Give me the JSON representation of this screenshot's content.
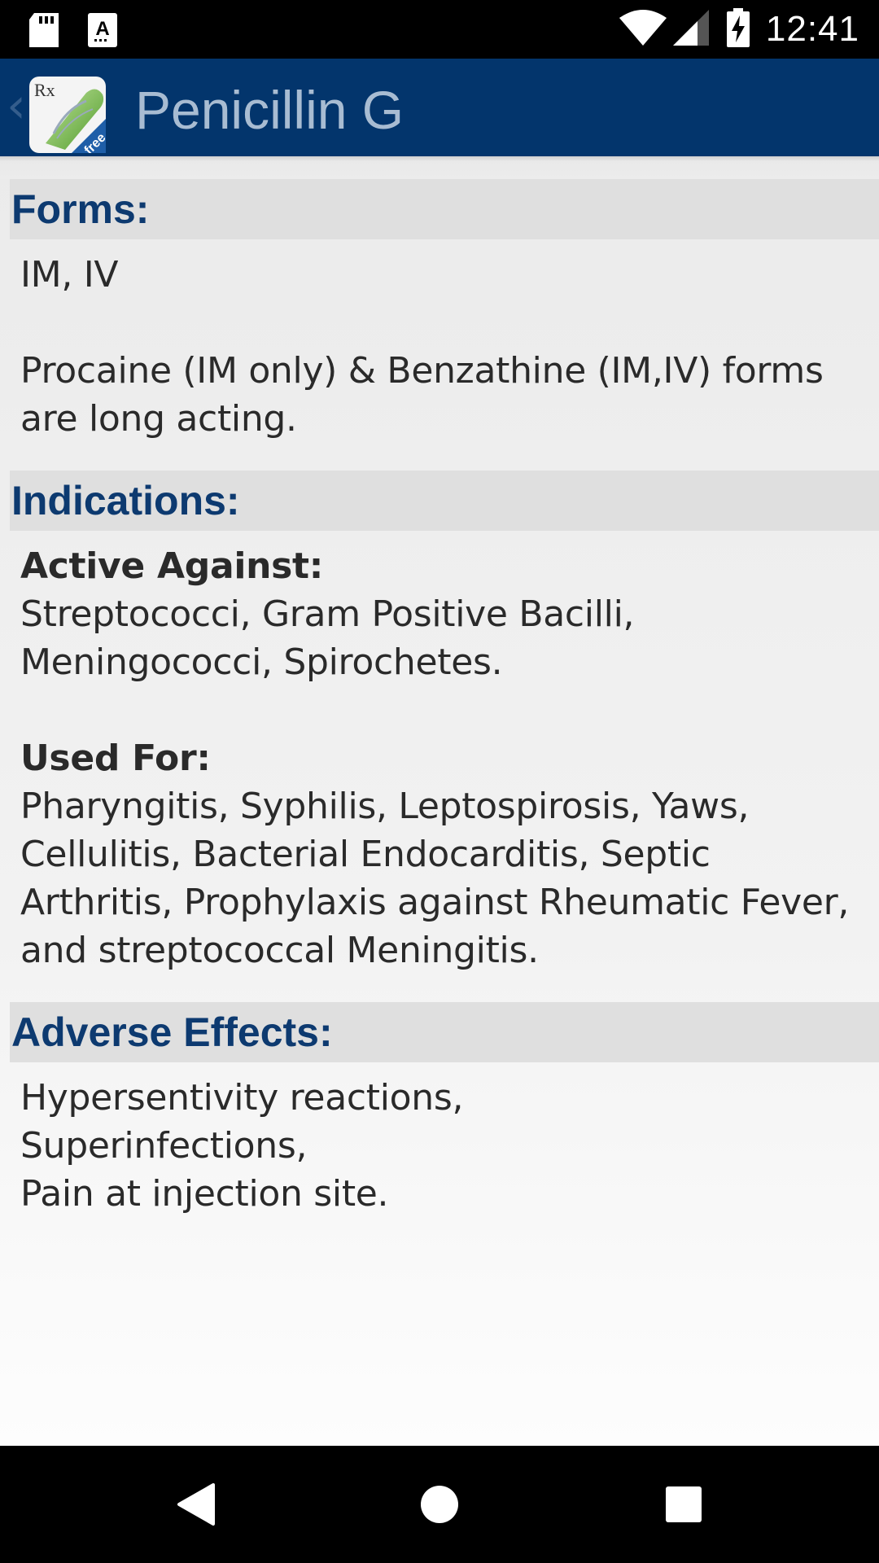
{
  "status_bar": {
    "time": "12:41",
    "icons": [
      "sd-card-icon",
      "notification-a-icon",
      "wifi-icon",
      "signal-icon",
      "battery-charging-icon"
    ]
  },
  "app_bar": {
    "title": "Penicillin G",
    "back_icon": "chevron-left-icon",
    "app_icon": "rx-pill-free-icon",
    "app_icon_text": {
      "rx": "Rx",
      "badge": "free"
    },
    "color": "#03356c"
  },
  "sections": {
    "forms": {
      "header": "Forms:",
      "para1": "IM, IV",
      "para2_lines": [
        "Procaine (IM only) & Benzathine (IM,IV) forms",
        "are long acting."
      ]
    },
    "indications": {
      "header": "Indications:",
      "active_label": "Active Against:",
      "active_lines": [
        "Streptococci, Gram Positive Bacilli,",
        "Meningococci, Spirochetes."
      ],
      "used_label": "Used For:",
      "used_lines": [
        "Pharyngitis, Syphilis, Leptospirosis, Yaws,",
        "Cellulitis, Bacterial Endocarditis, Septic",
        "Arthritis, Prophylaxis against Rheumatic Fever,",
        "and streptococcal Meningitis."
      ]
    },
    "adverse": {
      "header": "Adverse Effects:",
      "lines": [
        "Hypersentivity reactions,",
        "Superinfections,",
        "Pain at injection site."
      ]
    }
  },
  "nav_bar": {
    "buttons": [
      "back-triangle-icon",
      "home-circle-icon",
      "recents-square-icon"
    ]
  },
  "colors": {
    "header_text": "#0d3a70",
    "header_bg": "#dfdfdf",
    "body_text": "#2a2a2a"
  }
}
